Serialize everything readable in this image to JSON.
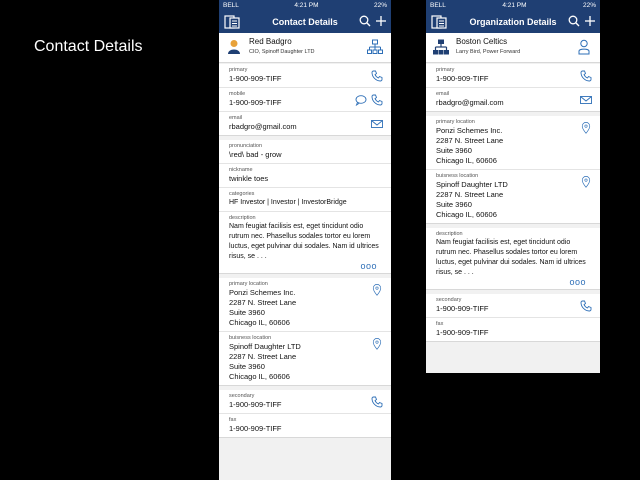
{
  "slide_title": "Contact Details",
  "colors": {
    "navbar": "#1f3f73",
    "accent": "#2e6fb7"
  },
  "left": {
    "status": {
      "carrier": "BELL",
      "time": "4:21 PM",
      "battery": "22%"
    },
    "nav_title": "Contact Details",
    "header": {
      "name": "Red Badgro",
      "subtitle": "CIO, Spinoff Daughter LTD"
    },
    "contact": {
      "primary_label": "primary",
      "primary_value": "1-900-909-TIFF",
      "mobile_label": "mobile",
      "mobile_value": "1-900-909-TIFF",
      "email_label": "email",
      "email_value": "rbadgro@gmail.com"
    },
    "info": {
      "pronunciation_label": "pronunciation",
      "pronunciation_value": "\\red\\ bad - grow",
      "nickname_label": "nickname",
      "nickname_value": "twinkle toes",
      "categories_label": "categories",
      "categories_value": "HF Investor  |  Investor  |  InvestorBridge",
      "description_label": "description",
      "description_value": "Nam feugiat facilisis est, eget tincidunt odio rutrum nec. Phasellus sodales tortor eu lorem luctus, eget pulvinar dui sodales. Nam id ultrices risus, se . . .",
      "more": "ooo"
    },
    "locations": {
      "primary_label": "primary location",
      "primary_lines": [
        "Ponzi Schemes Inc.",
        "2287 N. Street Lane",
        "Suite 3960",
        "Chicago IL, 60606"
      ],
      "business_label": "buisness location",
      "business_lines": [
        "Spinoff Daughter LTD",
        "2287 N. Street Lane",
        "Suite 3960",
        "Chicago IL, 60606"
      ]
    },
    "other": {
      "secondary_label": "secondary",
      "secondary_value": "1-900-909-TIFF",
      "fax_label": "fax",
      "fax_value": "1-900-909-TIFF"
    }
  },
  "right": {
    "status": {
      "carrier": "BELL",
      "time": "4:21 PM",
      "battery": "22%"
    },
    "nav_title": "Organization Details",
    "header": {
      "name": "Boston Celtics",
      "subtitle": "Larry Bird, Power Forward"
    },
    "contact": {
      "primary_label": "primary",
      "primary_value": "1-900-909-TIFF",
      "email_label": "email",
      "email_value": "rbadgro@gmail.com"
    },
    "locations": {
      "primary_label": "primary location",
      "primary_lines": [
        "Ponzi Schemes Inc.",
        "2287 N. Street Lane",
        "Suite 3960",
        "Chicago IL, 60606"
      ],
      "business_label": "buisness location",
      "business_lines": [
        "Spinoff Daughter LTD",
        "2287 N. Street Lane",
        "Suite 3960",
        "Chicago IL, 60606"
      ]
    },
    "description": {
      "label": "description",
      "value": "Nam feugiat facilisis est, eget tincidunt odio rutrum nec. Phasellus sodales tortor eu lorem luctus, eget pulvinar dui sodales. Nam id ultrices risus, se . . .",
      "more": "ooo"
    },
    "other": {
      "secondary_label": "secondary",
      "secondary_value": "1-900-909-TIFF",
      "fax_label": "fax",
      "fax_value": "1-900-909-TIFF"
    }
  }
}
